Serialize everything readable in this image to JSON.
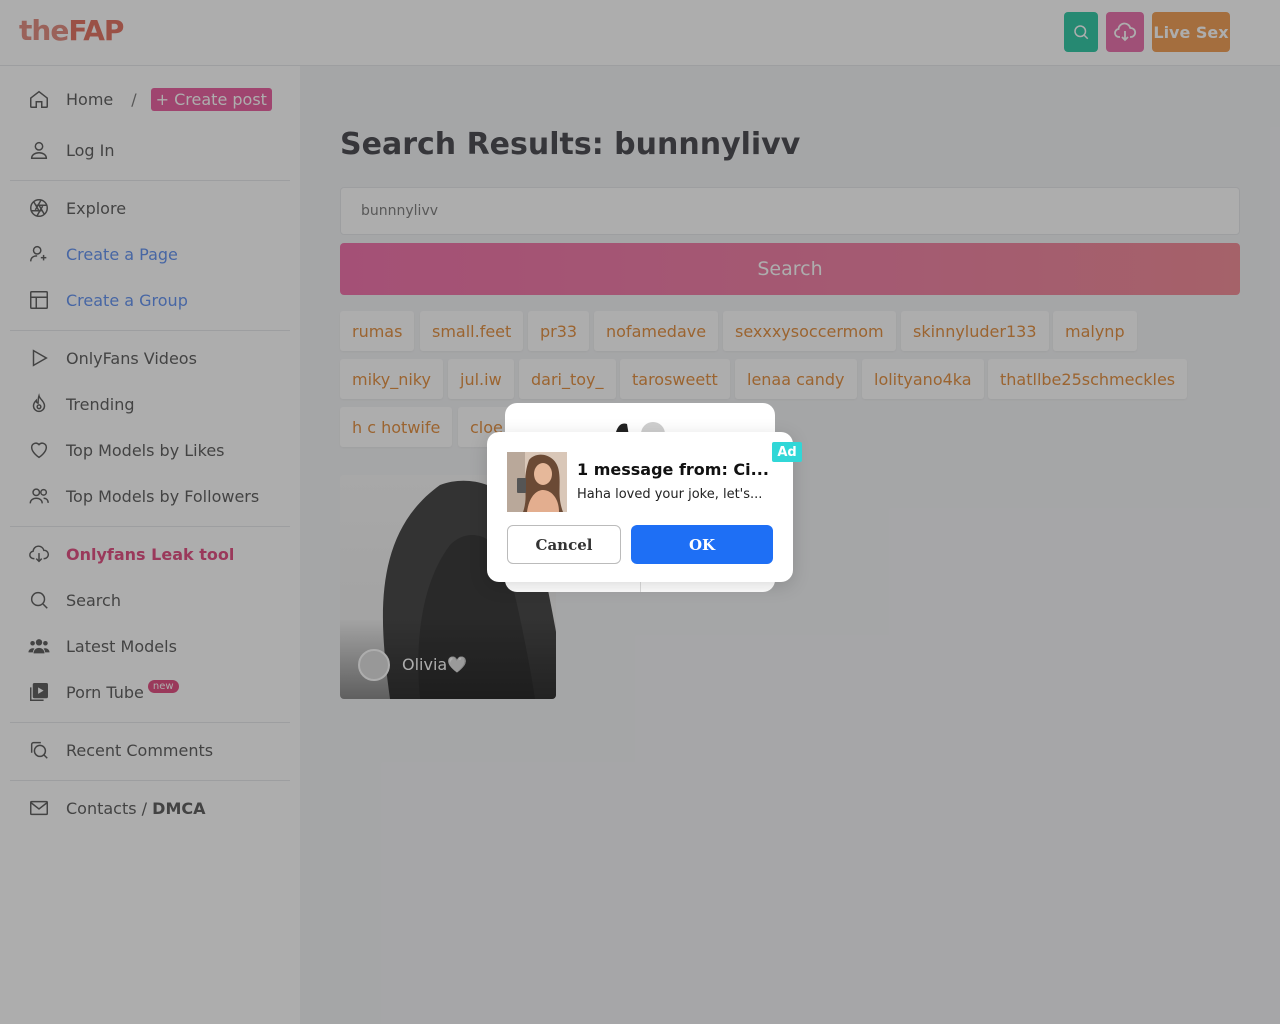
{
  "header": {
    "logo_the": "the",
    "logo_fap": "FAP",
    "live_label": "Live Sex"
  },
  "sidebar": {
    "home": "Home",
    "crumb_sep": "/",
    "create_post": "+ Create post",
    "login": "Log In",
    "explore": "Explore",
    "create_page": "Create a Page",
    "create_group": "Create a Group",
    "onlyfans_videos": "OnlyFans Videos",
    "trending": "Trending",
    "top_likes": "Top Models by Likes",
    "top_followers": "Top Models by Followers",
    "leak_tool": "Onlyfans Leak tool",
    "search": "Search",
    "latest_models": "Latest Models",
    "porn_tube": "Porn Tube",
    "new_badge": "new",
    "recent_comments": "Recent Comments",
    "contacts": "Contacts / ",
    "dmca": "DMCA"
  },
  "main": {
    "title": "Search Results: bunnnylivv",
    "search_value": "bunnnylivv",
    "search_button": "Search",
    "tags": [
      "rumas",
      "small.feet",
      "pr33",
      "nofamedave",
      "sexxxysoccermom",
      "skinnyluder133",
      "malynp",
      "miky_niky",
      "jul.iw",
      "dari_toy_",
      "tarosweett",
      "lenaa candy",
      "lolityano4ka",
      "thatllbe25schmeckles",
      "h c hotwife",
      "cloe"
    ],
    "card_name": "Olivia🤍"
  },
  "popup": {
    "ad_label": "Ad",
    "title": "1 message from: Ci...",
    "body": "Haha loved your joke, let's...",
    "cancel": "Cancel",
    "ok": "OK"
  },
  "colors": {
    "accent_pink": "#e9579b",
    "tag_text": "#e38a36",
    "ok_blue": "#1e6ff5"
  }
}
